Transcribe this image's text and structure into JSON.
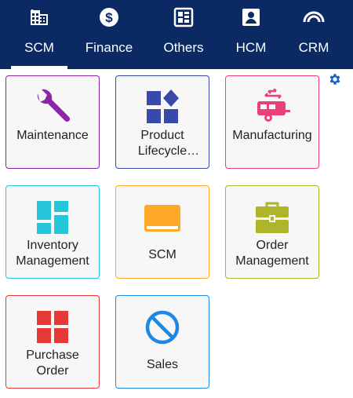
{
  "tabs": [
    {
      "label": "SCM",
      "icon": "building-icon"
    },
    {
      "label": "Finance",
      "icon": "dollar-icon"
    },
    {
      "label": "Others",
      "icon": "grid-icon"
    },
    {
      "label": "HCM",
      "icon": "badge-icon"
    },
    {
      "label": "CRM",
      "icon": "signal-icon"
    }
  ],
  "active_tab": "SCM",
  "tiles": [
    {
      "label": "Maintenance",
      "icon": "wrench-icon",
      "border": "#8e24aa",
      "icon_color": "#8e24aa"
    },
    {
      "label": "Product Lifecycle Management",
      "icon": "shapes-icon",
      "border": "#3949ab",
      "icon_color": "#3949ab"
    },
    {
      "label": "Manufacturing",
      "icon": "trailer-icon",
      "border": "#ec407a",
      "icon_color": "#ec407a"
    },
    {
      "label": "Inventory Management",
      "icon": "dashboard-icon",
      "border": "#26c6da",
      "icon_color": "#26c6da"
    },
    {
      "label": "SCM",
      "icon": "laptop-icon",
      "border": "#ffa726",
      "icon_color": "#ffa726"
    },
    {
      "label": "Order Management",
      "icon": "briefcase-icon",
      "border": "#afb42b",
      "icon_color": "#afb42b"
    },
    {
      "label": "Purchase Order",
      "icon": "window-icon",
      "border": "#e53935",
      "icon_color": "#e53935"
    },
    {
      "label": "Sales",
      "icon": "block-icon",
      "border": "#1e88e5",
      "icon_color": "#1e88e5"
    }
  ],
  "settings_icon": "gear-icon"
}
